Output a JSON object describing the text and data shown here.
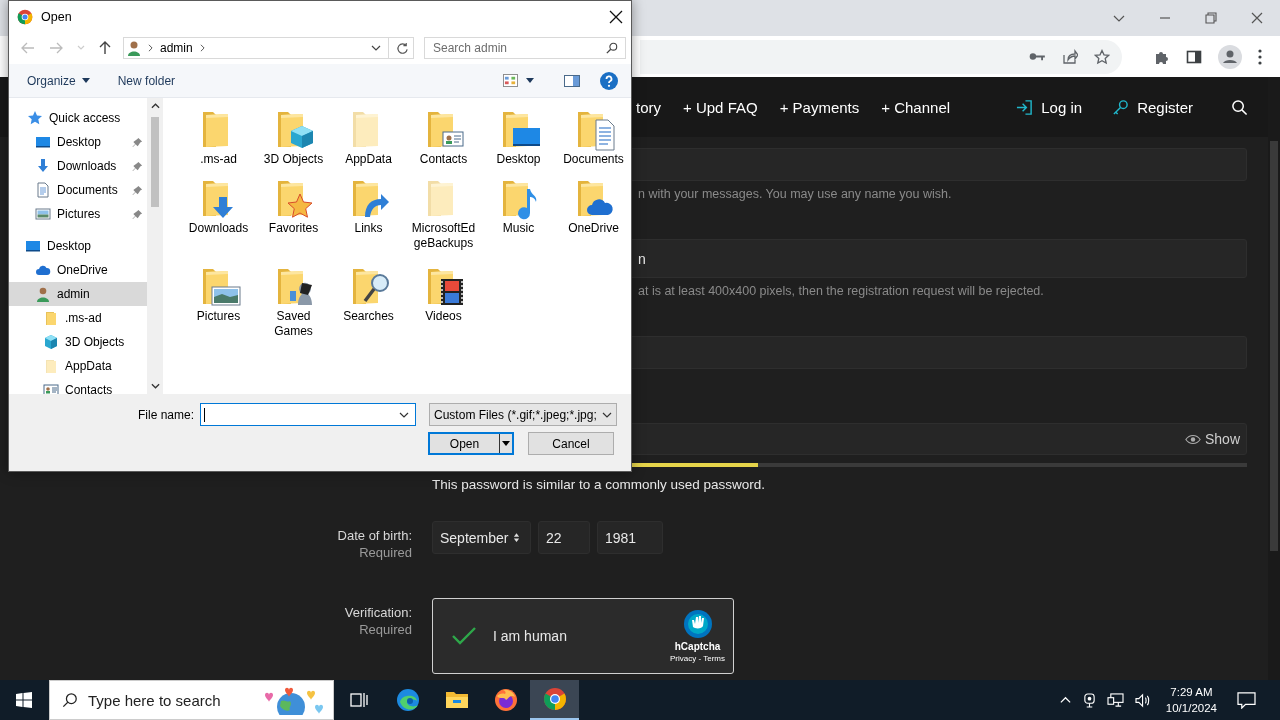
{
  "site_nav": {
    "items": [
      "tory",
      "+ Upd FAQ",
      "+ Payments",
      "+ Channel"
    ],
    "account_links": [
      "Log in",
      "Register"
    ]
  },
  "form": {
    "hints": [
      "n with your messages. You may use any name you wish.",
      "at is at least 400x400 pixels, then the registration request will be rejected."
    ],
    "email_value": "n",
    "password": {
      "toggle": "Show",
      "strength": {
        "level": 0.4
      },
      "message": "This password is similar to a commonly used password."
    },
    "date_of_birth": {
      "label": "Date of birth:",
      "note": "Required",
      "month": "September",
      "day": "22",
      "year": "1981"
    },
    "verification": {
      "label": "Verification:",
      "note": "Required",
      "captcha": {
        "checked": true,
        "text": "I am human",
        "brand": "hCaptcha",
        "links": "Privacy - Terms"
      }
    }
  },
  "dialog": {
    "title": "Open",
    "path": "admin",
    "search": {
      "placeholder": "Search admin"
    },
    "commands": [
      "Organize",
      "New folder"
    ],
    "nav": [
      {
        "label": "Quick access",
        "kind": "star",
        "selected": false,
        "pinned": false,
        "hidden": false,
        "children": [
          {
            "label": "Desktop",
            "kind": "desktop",
            "selected": false,
            "pinned": true,
            "hidden": false
          },
          {
            "label": "Downloads",
            "kind": "download",
            "selected": false,
            "pinned": true,
            "hidden": false
          },
          {
            "label": "Documents",
            "kind": "documents",
            "selected": false,
            "pinned": true,
            "hidden": false
          },
          {
            "label": "Pictures",
            "kind": "pictures",
            "selected": false,
            "pinned": true,
            "hidden": false
          }
        ]
      },
      {
        "label": "Desktop",
        "kind": "desktop",
        "selected": false,
        "pinned": false,
        "hidden": false,
        "children": [
          {
            "label": "OneDrive",
            "kind": "cloud",
            "selected": false,
            "pinned": false,
            "hidden": false
          },
          {
            "label": "admin",
            "kind": "user",
            "selected": true,
            "pinned": false,
            "hidden": false,
            "children": [
              {
                "label": ".ms-ad",
                "kind": "folder",
                "selected": false,
                "pinned": false,
                "hidden": false
              },
              {
                "label": "3D Objects",
                "kind": "cube",
                "selected": false,
                "pinned": false,
                "hidden": false
              },
              {
                "label": "AppData",
                "kind": "folder",
                "selected": false,
                "pinned": false,
                "hidden": true
              },
              {
                "label": "Contacts",
                "kind": "contacts",
                "selected": false,
                "pinned": false,
                "hidden": false
              }
            ]
          }
        ]
      }
    ],
    "items": [
      {
        "label": ".ms-ad",
        "kind": "plain",
        "hidden": false
      },
      {
        "label": "3D Objects",
        "kind": "cube",
        "hidden": false
      },
      {
        "label": "AppData",
        "kind": "plain",
        "hidden": true
      },
      {
        "label": "Contacts",
        "kind": "contacts",
        "hidden": false
      },
      {
        "label": "Desktop",
        "kind": "desktop",
        "hidden": false
      },
      {
        "label": "Documents",
        "kind": "documents",
        "hidden": false
      },
      {
        "label": "Downloads",
        "kind": "download",
        "hidden": false
      },
      {
        "label": "Favorites",
        "kind": "star",
        "hidden": false
      },
      {
        "label": "Links",
        "kind": "link",
        "hidden": false
      },
      {
        "label": "MicrosoftEdgeBackups",
        "kind": "plain",
        "hidden": true
      },
      {
        "label": "Music",
        "kind": "music",
        "hidden": false
      },
      {
        "label": "OneDrive",
        "kind": "cloud",
        "hidden": false
      },
      {
        "label": "Pictures",
        "kind": "pictures",
        "hidden": false
      },
      {
        "label": "Saved Games",
        "kind": "games",
        "hidden": false
      },
      {
        "label": "Searches",
        "kind": "search",
        "hidden": false
      },
      {
        "label": "Videos",
        "kind": "videos",
        "hidden": false
      }
    ],
    "file_name": {
      "label": "File name:"
    },
    "filter": "Custom Files (*.gif;*.jpeg;*.jpg;",
    "buttons": [
      "Open",
      "Cancel"
    ]
  },
  "taskbar": {
    "search": {
      "placeholder": "Type here to search"
    },
    "apps": [
      {
        "kind": "taskview",
        "selected": false
      },
      {
        "kind": "edge",
        "selected": false
      },
      {
        "kind": "files",
        "selected": false
      },
      {
        "kind": "firefox",
        "selected": false
      },
      {
        "kind": "chrome",
        "selected": true
      }
    ],
    "clock": {
      "time": "7:29 AM",
      "date": "10/1/2024"
    }
  }
}
